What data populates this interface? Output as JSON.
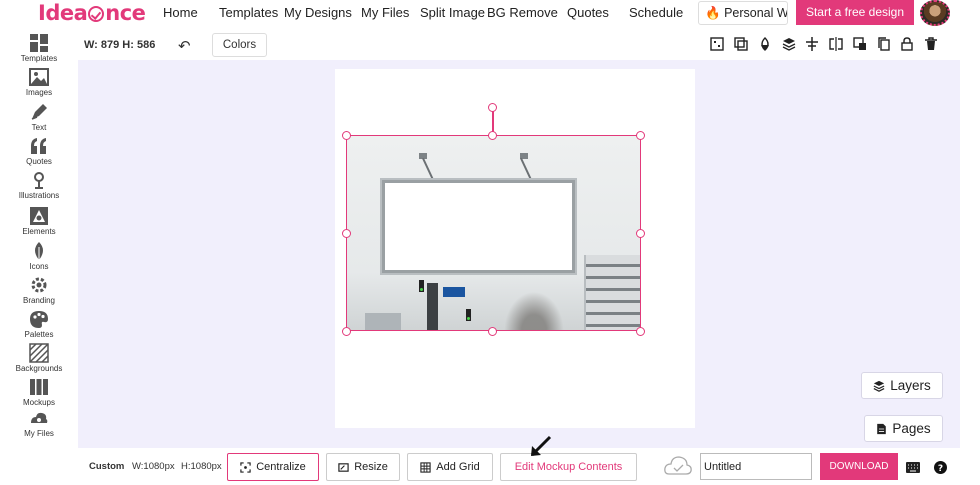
{
  "brand": {
    "logo_text_pre": "Idea",
    "logo_text_post": "nce",
    "accent": "#e2397a",
    "canvas_bg": "#f1effc"
  },
  "nav": {
    "items": [
      "Home",
      "Templates",
      "My Designs",
      "My Files",
      "Split Image",
      "BG Remove",
      "Quotes",
      "Schedule"
    ],
    "personal_label": "Personal W...",
    "cta_label": "Start a free design"
  },
  "sidebar": {
    "items": [
      {
        "label": "Templates",
        "icon": "templates-icon"
      },
      {
        "label": "Images",
        "icon": "images-icon"
      },
      {
        "label": "Text",
        "icon": "pen-icon"
      },
      {
        "label": "Quotes",
        "icon": "quotes-icon"
      },
      {
        "label": "Illustrations",
        "icon": "illustration-icon"
      },
      {
        "label": "Elements",
        "icon": "elements-icon"
      },
      {
        "label": "Icons",
        "icon": "leaf-icon"
      },
      {
        "label": "Branding",
        "icon": "gear-icon"
      },
      {
        "label": "Palettes",
        "icon": "palette-icon"
      },
      {
        "label": "Backgrounds",
        "icon": "backgrounds-icon"
      },
      {
        "label": "Mockups",
        "icon": "mockups-icon"
      },
      {
        "label": "My Files",
        "icon": "my-files-icon"
      }
    ]
  },
  "toolbar": {
    "dimensions": "W: 879 H: 586",
    "colors_label": "Colors",
    "tools": [
      "transparency-icon",
      "duplicate-layer-icon",
      "opacity-icon",
      "layers-stack-icon",
      "align-icon",
      "flip-horizontal-icon",
      "flip-vertical-icon",
      "copy-icon",
      "lock-icon",
      "delete-icon"
    ]
  },
  "canvas": {
    "side_buttons": {
      "layers_label": "Layers",
      "pages_label": "Pages"
    }
  },
  "bottombar": {
    "size_label": "Custom",
    "width_label": "W:1080px",
    "height_label": "H:1080px",
    "centralize_label": "Centralize",
    "resize_label": "Resize",
    "add_grid_label": "Add Grid",
    "edit_mockup_label": "Edit Mockup Contents",
    "title_value": "Untitled",
    "download_label": "DOWNLOAD"
  }
}
